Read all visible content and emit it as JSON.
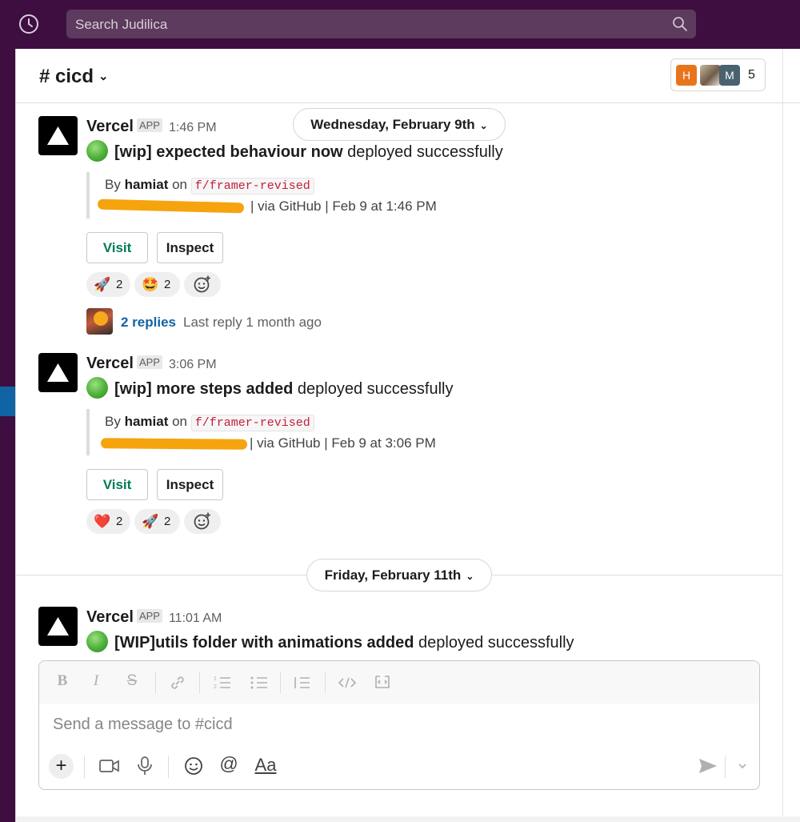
{
  "search": {
    "placeholder": "Search Judilica"
  },
  "channel": {
    "name": "# cicd",
    "caret": "⌄"
  },
  "members": {
    "avatars": [
      {
        "initial": "H",
        "color": "#e8741c"
      },
      {
        "initial": "",
        "color": "#7a6a58"
      },
      {
        "initial": "M",
        "color": "#4a6170"
      }
    ],
    "count": "5"
  },
  "date_dividers": [
    {
      "label": "Wednesday, February 9th",
      "chevron": "⌄"
    },
    {
      "label": "Friday, February 11th",
      "chevron": "⌄"
    }
  ],
  "messages": [
    {
      "sender": "Vercel",
      "badge": "APP",
      "time": "1:46 PM",
      "title_bold": "[wip] expected behaviour now",
      "title_rest": " deployed successfully",
      "by_prefix": "By ",
      "author": "hamiat",
      "on": " on ",
      "branch": "f/framer-revised",
      "meta": "| via GitHub | Feb 9 at 1:46 PM",
      "buttons": {
        "visit": "Visit",
        "inspect": "Inspect"
      },
      "reactions": [
        {
          "emoji": "🚀",
          "count": "2"
        },
        {
          "emoji": "🤩",
          "count": "2"
        }
      ],
      "replies": {
        "count_label": "2 replies",
        "last": "Last reply 1 month ago"
      }
    },
    {
      "sender": "Vercel",
      "badge": "APP",
      "time": "3:06 PM",
      "title_bold": "[wip] more steps added",
      "title_rest": " deployed successfully",
      "by_prefix": "By ",
      "author": "hamiat",
      "on": " on ",
      "branch": "f/framer-revised",
      "meta": "| via GitHub | Feb 9 at 3:06 PM",
      "buttons": {
        "visit": "Visit",
        "inspect": "Inspect"
      },
      "reactions": [
        {
          "emoji": "❤️",
          "count": "2"
        },
        {
          "emoji": "🚀",
          "count": "2"
        }
      ]
    },
    {
      "sender": "Vercel",
      "badge": "APP",
      "time": "11:01 AM",
      "title_bold": "[WIP]utils folder with animations added",
      "title_rest": " deployed successfully"
    }
  ],
  "composer": {
    "placeholder": "Send a message to #cicd",
    "format_icons": [
      "bold-icon",
      "italic-icon",
      "strikethrough-icon",
      "link-icon",
      "ordered-list-icon",
      "bulleted-list-icon",
      "blockquote-icon",
      "code-icon",
      "code-block-icon"
    ],
    "action_icons": [
      "plus-icon",
      "video-icon",
      "microphone-icon",
      "emoji-icon",
      "mention-icon",
      "formatting-icon",
      "send-icon",
      "send-options-icon"
    ],
    "format_label": "Aa"
  },
  "colors": {
    "sidebar": "#3f0e40",
    "accent": "#1164a3",
    "visit_green": "#007a5a",
    "branch_red": "#c41e3a",
    "redaction": "#f5a40d"
  }
}
